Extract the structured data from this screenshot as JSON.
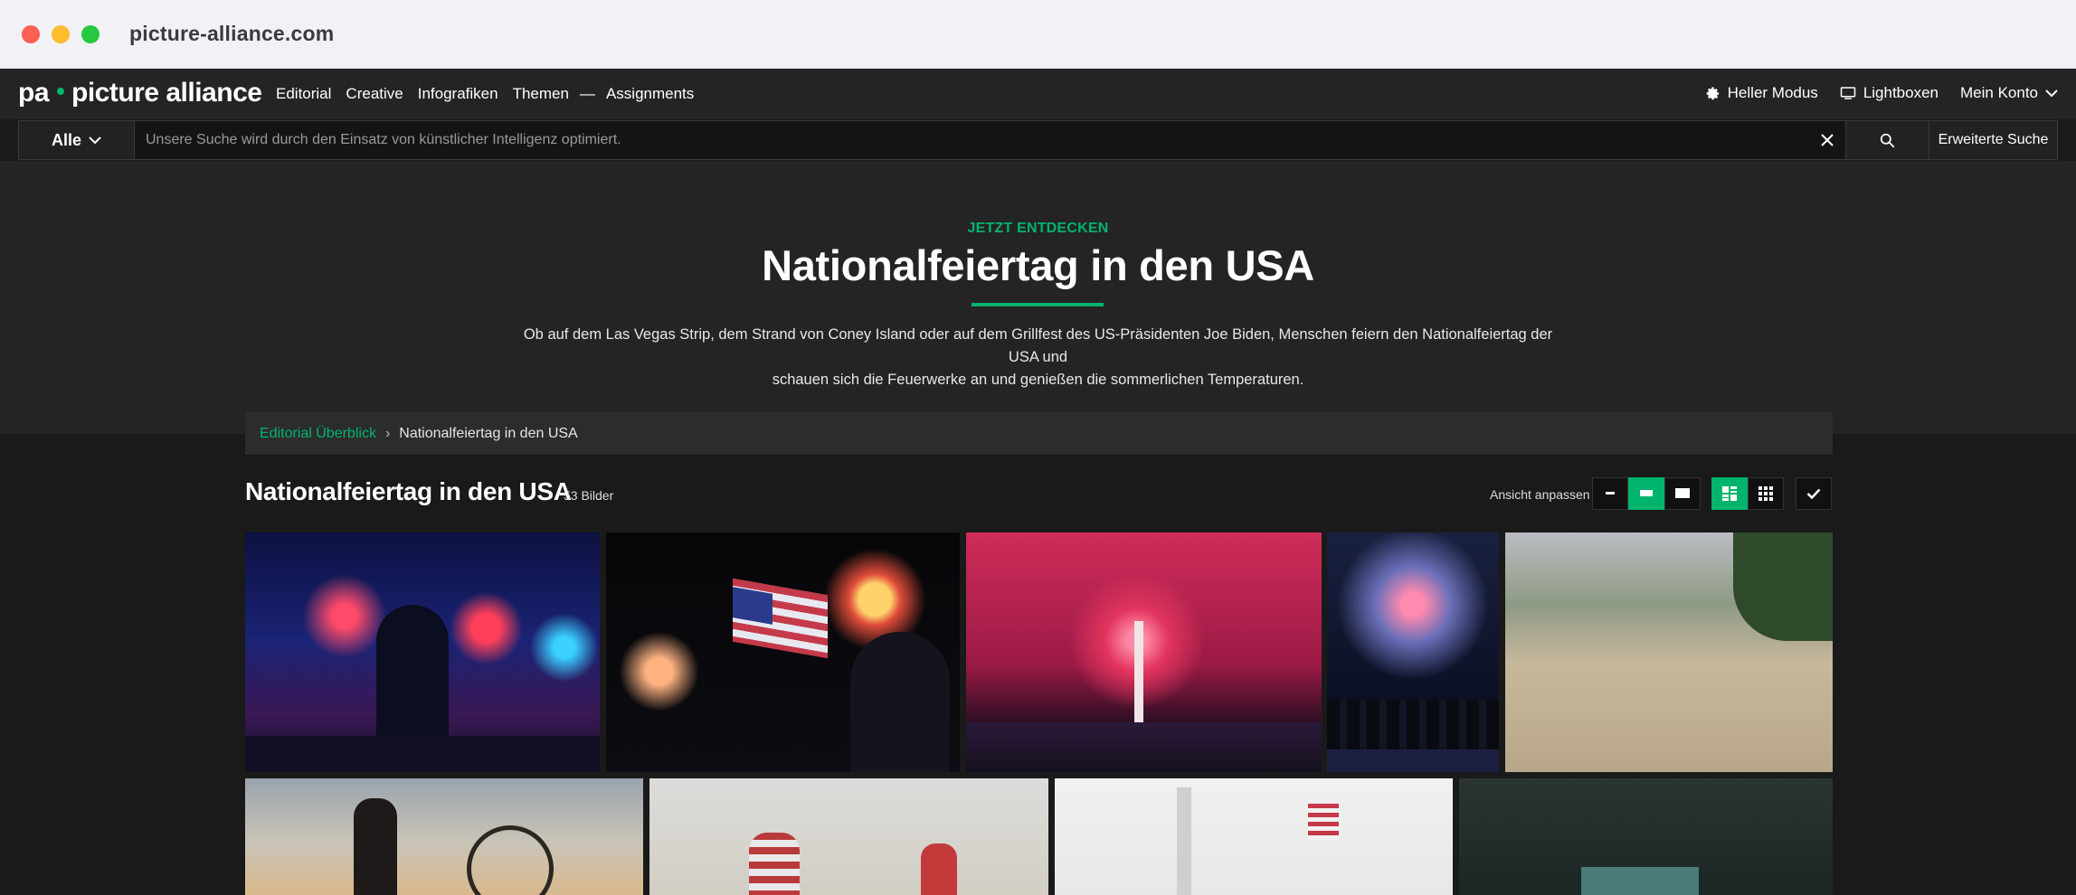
{
  "browser": {
    "url": "picture-alliance.com"
  },
  "header": {
    "logo": {
      "left": "pa",
      "right": "picture alliance"
    },
    "nav": [
      "Editorial",
      "Creative",
      "Infografiken",
      "Themen",
      "—",
      "Assignments"
    ],
    "light_mode": "Heller Modus",
    "lightboxes": "Lightboxen",
    "account": "Mein Konto"
  },
  "search": {
    "scope": "Alle",
    "placeholder": "Unsere Suche wird durch den Einsatz von künstlicher Intelligenz optimiert.",
    "advanced": "Erweiterte Suche"
  },
  "hero": {
    "kicker": "JETZT ENTDECKEN",
    "title": "Nationalfeiertag in den USA",
    "description_line1": "Ob auf dem Las Vegas Strip, dem Strand von Coney Island oder auf dem Grillfest des US-Präsidenten Joe Biden, Menschen feiern den Nationalfeiertag der USA und",
    "description_line2": "schauen sich die Feuerwerke an und genießen die sommerlichen Temperaturen."
  },
  "breadcrumb": {
    "link": "Editorial Überblick",
    "separator": "›",
    "current": "Nationalfeiertag in den USA"
  },
  "section": {
    "title": "Nationalfeiertag in den USA",
    "count": "53 Bilder",
    "view_label": "Ansicht anpassen"
  },
  "colors": {
    "accent": "#00b46e",
    "background": "#1a1a1a",
    "panel": "#242424"
  }
}
